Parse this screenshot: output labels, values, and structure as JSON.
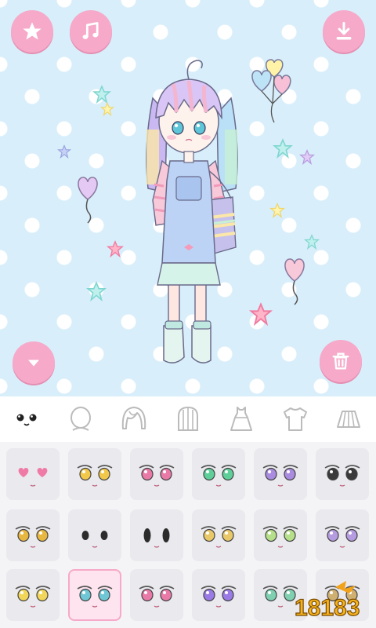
{
  "toolbar": {
    "favorite_icon": "star-icon",
    "music_icon": "music-note-icon",
    "download_icon": "download-icon",
    "collapse_icon": "triangle-down-icon",
    "delete_icon": "trash-icon"
  },
  "colors": {
    "stage_background": "#d8eefa",
    "accent_pink": "#f6a9c8",
    "selected_border": "#f6a9c8"
  },
  "categories": [
    {
      "name": "face",
      "icon": "face-icon",
      "selected": true
    },
    {
      "name": "head",
      "icon": "head-icon",
      "selected": false
    },
    {
      "name": "hair-front",
      "icon": "hair-front-icon",
      "selected": false
    },
    {
      "name": "hair-back",
      "icon": "hair-back-icon",
      "selected": false
    },
    {
      "name": "dress",
      "icon": "dress-icon",
      "selected": false
    },
    {
      "name": "shirt",
      "icon": "shirt-icon",
      "selected": false
    },
    {
      "name": "skirt",
      "icon": "skirt-icon",
      "selected": false
    }
  ],
  "face_items": {
    "selected_index": 13,
    "eye_colors": [
      "#f07aa6",
      "#f2c84b",
      "#e97aa8",
      "#5fcf9a",
      "#a98be0",
      "#3a3a3a",
      "#e8b740",
      "#2c2c2c",
      "#2c2c2c",
      "#e9c86a",
      "#b6df8a",
      "#b59be0",
      "#f2d65a",
      "#6fc7d6",
      "#e97aa8",
      "#9a7be6",
      "#7fd0b0",
      "#d0b070"
    ]
  },
  "watermark": {
    "text": "18183"
  }
}
